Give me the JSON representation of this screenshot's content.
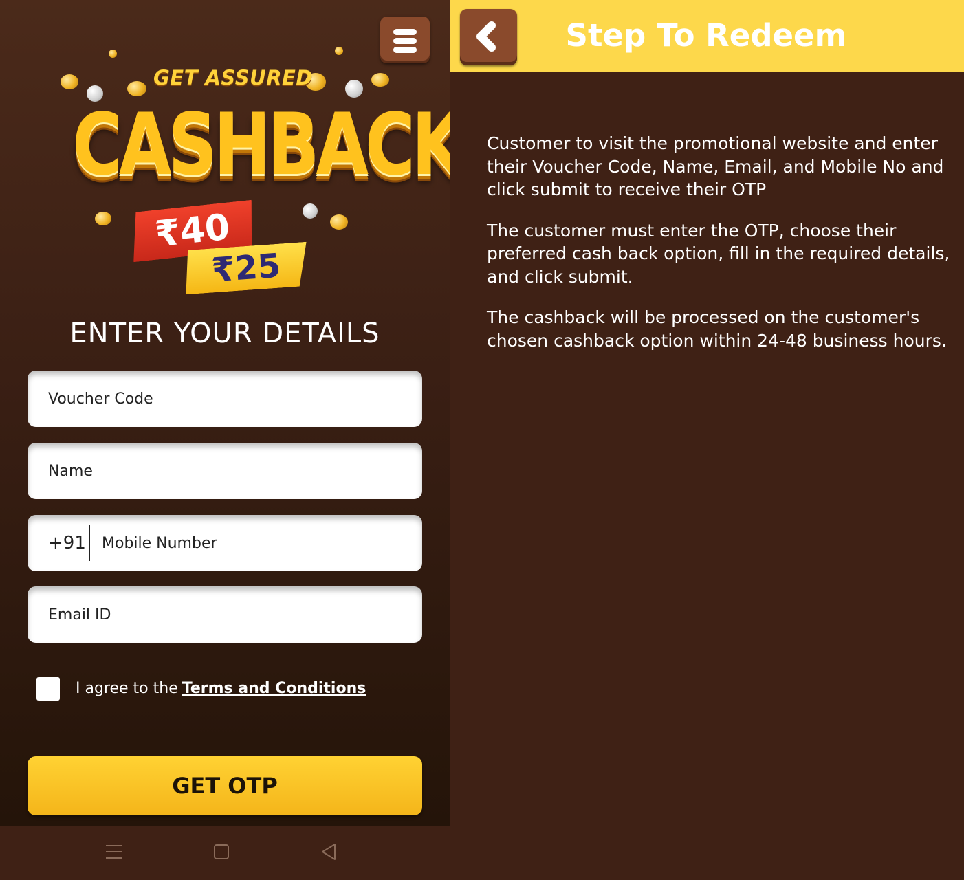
{
  "left_screen": {
    "banner": {
      "tagline": "GET ASSURED",
      "headline": "CASHBACK",
      "price_primary": "₹40",
      "price_secondary": "₹25"
    },
    "form": {
      "heading": "ENTER YOUR DETAILS",
      "voucher_placeholder": "Voucher Code",
      "name_placeholder": "Name",
      "country_code": "+91",
      "mobile_placeholder": "Mobile Number",
      "email_placeholder": "Email ID",
      "agree_text": "I agree to the",
      "terms_link": "Terms and Conditions",
      "submit_label": "GET OTP"
    },
    "icons": {
      "menu": "menu-icon",
      "nav_menu": "recent-apps-icon",
      "nav_home": "home-icon",
      "nav_back": "back-triangle-icon"
    }
  },
  "right_screen": {
    "title": "Step To Redeem",
    "steps": [
      "Customer to visit the promotional website and enter their Voucher Code, Name, Email, and Mobile No and click submit to receive their OTP",
      "The customer must enter the OTP, choose their preferred cash back option, fill in the required details, and click submit.",
      "The cashback will be processed on the customer's chosen cashback option within 24-48 business hours."
    ],
    "icons": {
      "back": "chevron-left-icon"
    }
  },
  "colors": {
    "background_brown": "#3f2115",
    "header_yellow": "#fdd84b",
    "button_yellow": "#f4b51a",
    "button_brown": "#8a4a2c"
  }
}
